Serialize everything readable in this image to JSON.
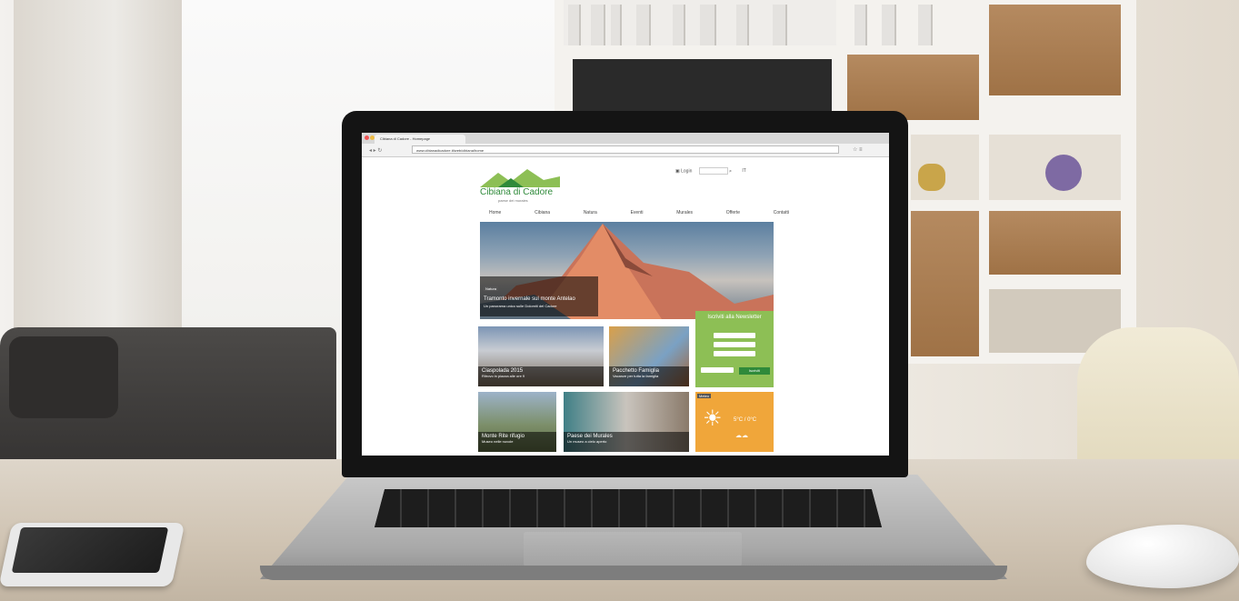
{
  "browser": {
    "tab_title": "Cibiana di Cadore - Homepage",
    "url": "www.cibianadicadore.it/web/cibiana/home"
  },
  "site": {
    "logo_title": "Cibiana di Cadore",
    "logo_subtitle": "paese dei murales",
    "utility": {
      "login": "Login",
      "search": "Cerca",
      "lang": "IT"
    },
    "nav": [
      "Home",
      "Cibiana",
      "Natura",
      "Eventi",
      "Murales",
      "Offerte",
      "Contatti"
    ],
    "hero": {
      "tag": "Natura",
      "title": "Tramonto invernale sul monte Antelao",
      "text": "Un panorama unico sulle Dolomiti del Cadore"
    },
    "tiles": [
      {
        "tag": "Eventi",
        "title": "Ciaspolada 2015",
        "text": "Ritrovo in piazza alle ore 9"
      },
      {
        "tag": "Eventi",
        "title": "Pacchetto Famiglia",
        "text": "Vacanze per tutta la famiglia"
      },
      {
        "tag": "Natura",
        "title": "Monte Rite rifugio",
        "text": "Museo nelle nuvole"
      },
      {
        "tag": "Murales",
        "title": "Paese dei Murales",
        "text": "Un museo a cielo aperto"
      }
    ],
    "newsletter": {
      "title": "Iscriviti alla Newsletter",
      "button": "Iscriviti"
    },
    "weather": {
      "tag": "Meteo",
      "temp": "5°C / 0°C"
    }
  },
  "colors": {
    "brand_green": "#2f8a3a",
    "newsletter_green": "#8dbf55",
    "weather_orange": "#f0a63a"
  }
}
